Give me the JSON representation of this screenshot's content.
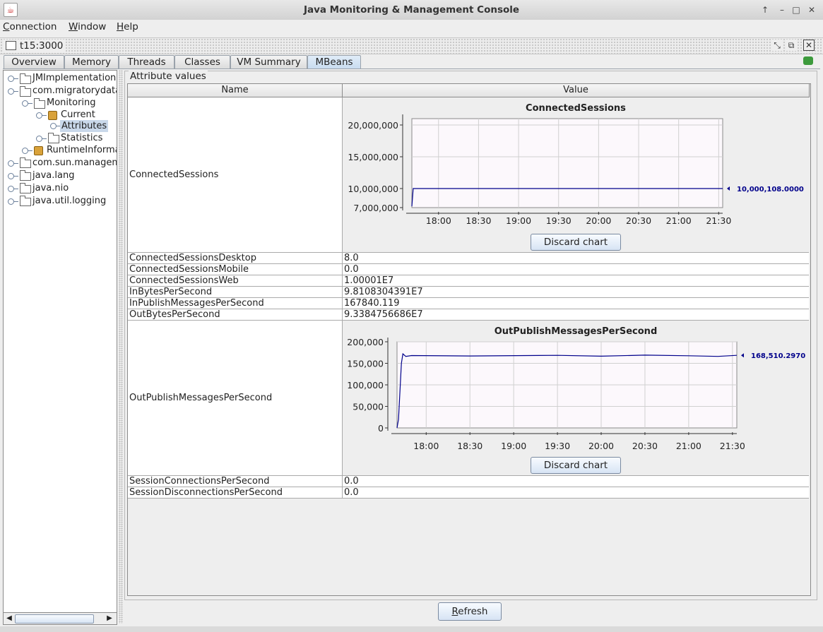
{
  "window": {
    "title": "Java Monitoring & Management Console",
    "buttons": [
      "↑",
      "–",
      "□",
      "✕"
    ]
  },
  "menu": {
    "connection": {
      "mnemonic": "C",
      "rest": "onnection"
    },
    "window": {
      "mnemonic": "W",
      "rest": "indow"
    },
    "help": {
      "mnemonic": "H",
      "rest": "elp"
    }
  },
  "frame": {
    "title": "t15:3000"
  },
  "tabs": [
    "Overview",
    "Memory",
    "Threads",
    "Classes",
    "VM Summary",
    "MBeans"
  ],
  "active_tab": "MBeans",
  "tree": {
    "nodes": [
      {
        "label": "JMImplementation",
        "icon": "folder-icon"
      },
      {
        "label": "com.migratorydata",
        "icon": "folder-icon"
      },
      {
        "label": "Monitoring",
        "icon": "folder-icon"
      },
      {
        "label": "Current",
        "icon": "bean-icon"
      },
      {
        "label": "Attributes",
        "icon": "none",
        "selected": true
      },
      {
        "label": "Statistics",
        "icon": "folder-icon"
      },
      {
        "label": "RuntimeInforma",
        "icon": "bean-icon"
      },
      {
        "label": "com.sun.managem",
        "icon": "folder-icon"
      },
      {
        "label": "java.lang",
        "icon": "folder-icon"
      },
      {
        "label": "java.nio",
        "icon": "folder-icon"
      },
      {
        "label": "java.util.logging",
        "icon": "folder-icon"
      }
    ]
  },
  "attributes": {
    "group_title": "Attribute values",
    "headers": {
      "name": "Name",
      "value": "Value"
    },
    "rows": [
      {
        "name": "ConnectedSessions",
        "value": ""
      },
      {
        "name": "ConnectedSessionsDesktop",
        "value": "8.0"
      },
      {
        "name": "ConnectedSessionsMobile",
        "value": "0.0"
      },
      {
        "name": "ConnectedSessionsWeb",
        "value": "1.00001E7"
      },
      {
        "name": "InBytesPerSecond",
        "value": "9.8108304391E7"
      },
      {
        "name": "InPublishMessagesPerSecond",
        "value": "167840.119"
      },
      {
        "name": "OutBytesPerSecond",
        "value": "9.3384756686E7"
      },
      {
        "name": "OutPublishMessagesPerSecond",
        "value": ""
      },
      {
        "name": "SessionConnectionsPerSecond",
        "value": "0.0"
      },
      {
        "name": "SessionDisconnectionsPerSecond",
        "value": "0.0"
      }
    ],
    "discard_label": "Discard chart"
  },
  "refresh": {
    "mnemonic": "R",
    "rest": "efresh"
  },
  "colors": {
    "line": "#00008b",
    "plot_bg": "#fcf8fc",
    "grid": "#d0d0d0",
    "latest_label": "#00008b"
  },
  "chart_data": [
    {
      "type": "line",
      "title": "ConnectedSessions",
      "xlabel": "",
      "ylabel": "",
      "x_ticks": [
        "18:00",
        "18:30",
        "19:00",
        "19:30",
        "20:00",
        "20:30",
        "21:00",
        "21:30"
      ],
      "y_ticks": [
        "20,000,000",
        "15,000,000",
        "10,000,000",
        "7,000,000"
      ],
      "ylim": [
        7000000,
        21000000
      ],
      "xlim": [
        "17:40",
        "21:33"
      ],
      "series": [
        {
          "x": [
            "17:40",
            "17:41",
            "21:33"
          ],
          "values": [
            7200000,
            10000108,
            10000108
          ]
        }
      ],
      "latest_label": "10,000,108.0000",
      "grid": true
    },
    {
      "type": "line",
      "title": "OutPublishMessagesPerSecond",
      "xlabel": "",
      "ylabel": "",
      "x_ticks": [
        "18:00",
        "18:30",
        "19:00",
        "19:30",
        "20:00",
        "20:30",
        "21:00",
        "21:30"
      ],
      "y_ticks": [
        "200,000",
        "150,000",
        "100,000",
        "50,000",
        "0"
      ],
      "ylim": [
        0,
        200000
      ],
      "xlim": [
        "17:40",
        "21:33"
      ],
      "series": [
        {
          "x": [
            "17:40",
            "17:41",
            "17:43",
            "17:44",
            "17:46",
            "17:50",
            "18:30",
            "19:30",
            "20:00",
            "20:30",
            "21:00",
            "21:20",
            "21:33"
          ],
          "values": [
            0,
            20000,
            150000,
            172000,
            166000,
            168000,
            167000,
            168500,
            166500,
            169000,
            167500,
            166000,
            168510
          ]
        }
      ],
      "latest_label": "168,510.2970",
      "grid": true
    }
  ]
}
